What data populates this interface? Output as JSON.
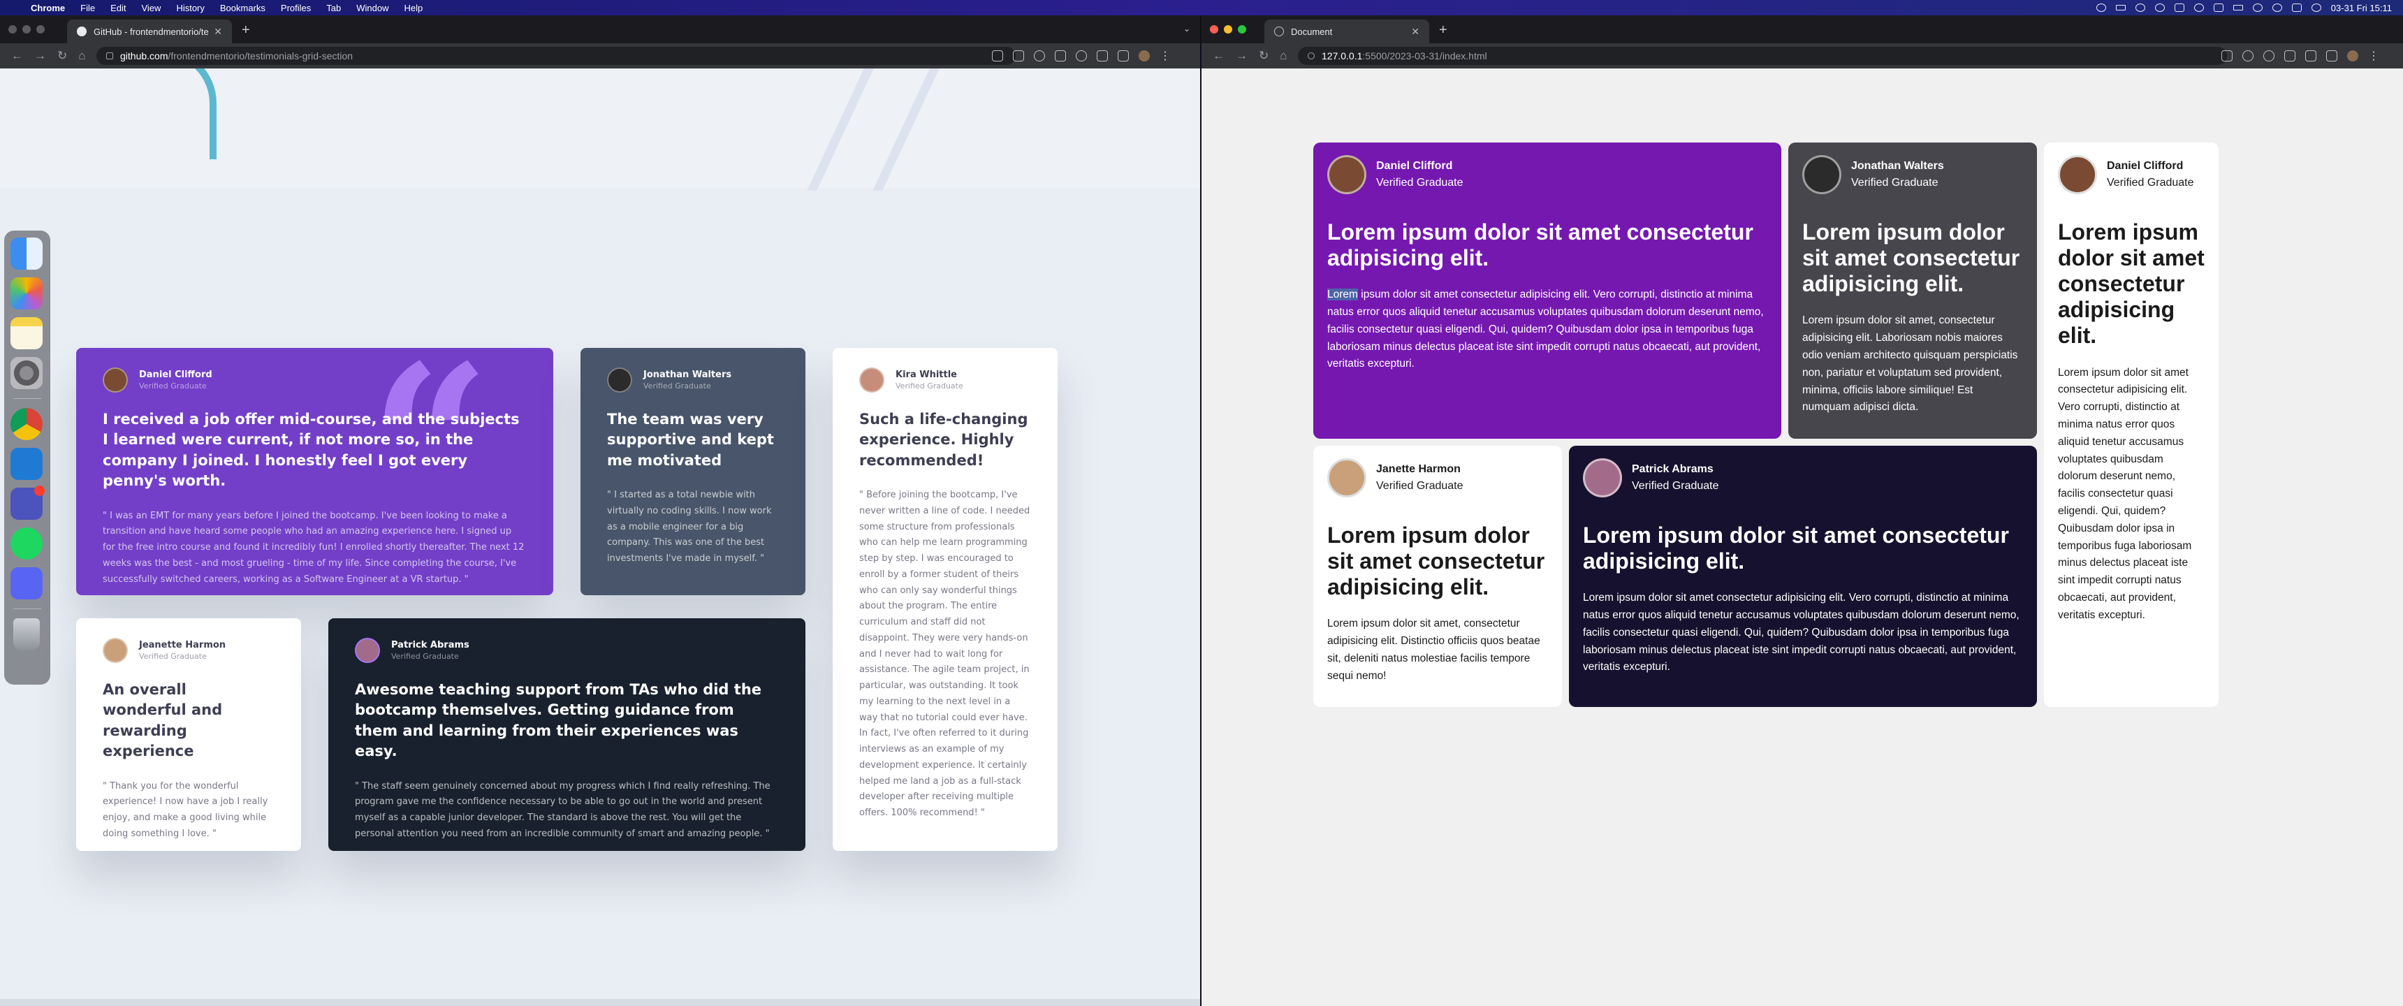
{
  "menubar": {
    "apple": "",
    "items": [
      "Chrome",
      "File",
      "Edit",
      "View",
      "History",
      "Bookmarks",
      "Profiles",
      "Tab",
      "Window",
      "Help"
    ],
    "clock": "03-31 Fri 15:11"
  },
  "left_window": {
    "tab_title": "GitHub - frontendmentorio/te",
    "url_host": "github.com",
    "url_path": "/frontendmentorio/testimonials-grid-section",
    "design": {
      "cards": [
        {
          "name": "Daniel Clifford",
          "role": "Verified Graduate",
          "quote": "I received a job offer mid-course, and the subjects I learned were current, if not more so, in the company I joined. I honestly feel I got every penny's worth.",
          "body": "\" I was an EMT for many years before I joined the bootcamp. I've been looking to make a transition and have heard some people who had an amazing experience here. I signed up for the free intro course and found it incredibly fun! I enrolled shortly thereafter. The next 12 weeks was the best - and most grueling - time of my life. Since completing the course, I've successfully switched careers, working as a Software Engineer at a VR startup. \""
        },
        {
          "name": "Jonathan Walters",
          "role": "Verified Graduate",
          "quote": "The team was very supportive and kept me motivated",
          "body": "\" I started as a total newbie with virtually no coding skills. I now work as a mobile engineer for a big company. This was one of the best investments I've made in myself. \""
        },
        {
          "name": "Kira Whittle",
          "role": "Verified Graduate",
          "quote": "Such a life-changing experience. Highly recommended!",
          "body": "\" Before joining the bootcamp, I've never written a line of code. I needed some structure from professionals who can help me learn programming step by step. I was encouraged to enroll by a former student of theirs who can only say wonderful things about the program. The entire curriculum and staff did not disappoint. They were very hands-on and I never had to wait long for assistance. The agile team project, in particular, was outstanding. It took my learning to the next level in a way that no tutorial could ever have. In fact, I've often referred to it during interviews as an example of my development experience. It certainly helped me land a job as a full-stack developer after receiving multiple offers. 100% recommend! \""
        },
        {
          "name": "Jeanette Harmon",
          "role": "Verified Graduate",
          "quote": "An overall wonderful and rewarding experience",
          "body": "\" Thank you for the wonderful experience! I now have a job I really enjoy, and make a good living while doing something I love. \""
        },
        {
          "name": "Patrick Abrams",
          "role": "Verified Graduate",
          "quote": "Awesome teaching support from TAs who did the bootcamp themselves. Getting guidance from them and learning from their experiences was easy.",
          "body": "\" The staff seem genuinely concerned about my progress which I find really refreshing. The program gave me the confidence necessary to be able to go out in the world and present myself as a capable junior developer. The standard is above the rest. You will get the personal attention you need from an incredible community of smart and amazing people. \""
        }
      ]
    }
  },
  "right_window": {
    "tab_title": "Document",
    "url_host": "127.0.0.1",
    "url_path": ":5500/2023-03-31/index.html",
    "cards": [
      {
        "name": "Daniel Clifford",
        "role": "Verified Graduate",
        "quote": "Lorem ipsum dolor sit amet consectetur adipisicing elit.",
        "body_selected": "Lorem",
        "body": " ipsum dolor sit amet consectetur adipisicing elit. Vero corrupti, distinctio at minima natus error quos aliquid tenetur accusamus voluptates quibusdam dolorum deserunt nemo, facilis consectetur quasi eligendi. Qui, quidem? Quibusdam dolor ipsa in temporibus fuga laboriosam minus delectus placeat iste sint impedit corrupti natus obcaecati, aut provident, veritatis excepturi."
      },
      {
        "name": "Jonathan Walters",
        "role": "Verified Graduate",
        "quote": "Lorem ipsum dolor sit amet consectetur adipisicing elit.",
        "body": "Lorem ipsum dolor sit amet, consectetur adipisicing elit. Laboriosam nobis maiores odio veniam architecto quisquam perspiciatis non, pariatur et voluptatum sed provident, minima, officiis labore similique! Est numquam adipisci dicta."
      },
      {
        "name": "Daniel Clifford",
        "role": "Verified Graduate",
        "quote": "Lorem ipsum dolor sit amet consectetur adipisicing elit.",
        "body": "Lorem ipsum dolor sit amet consectetur adipisicing elit. Vero corrupti, distinctio at minima natus error quos aliquid tenetur accusamus voluptates quibusdam dolorum deserunt nemo, facilis consectetur quasi eligendi. Qui, quidem? Quibusdam dolor ipsa in temporibus fuga laboriosam minus delectus placeat iste sint impedit corrupti natus obcaecati, aut provident, veritatis excepturi."
      },
      {
        "name": "Janette Harmon",
        "role": "Verified Graduate",
        "quote": "Lorem ipsum dolor sit amet consectetur adipisicing elit.",
        "body": "Lorem ipsum dolor sit amet, consectetur adipisicing elit. Distinctio officiis quos beatae sit, deleniti natus molestiae facilis tempore sequi nemo!"
      },
      {
        "name": "Patrick Abrams",
        "role": "Verified Graduate",
        "quote": "Lorem ipsum dolor sit amet consectetur adipisicing elit.",
        "body": "Lorem ipsum dolor sit amet consectetur adipisicing elit. Vero corrupti, distinctio at minima natus error quos aliquid tenetur accusamus voluptates quibusdam dolorum deserunt nemo, facilis consectetur quasi eligendi. Qui, quidem? Quibusdam dolor ipsa in temporibus fuga laboriosam minus delectus placeat iste sint impedit corrupti natus obcaecati, aut provident, veritatis excepturi."
      }
    ]
  },
  "dock": {
    "apps": [
      "finder-icon",
      "photos-icon",
      "notes-icon",
      "system-settings-icon",
      "chrome-icon",
      "vscode-icon",
      "teams-icon",
      "spotify-icon",
      "discord-icon",
      "trash-icon"
    ]
  },
  "colors": {
    "purple": "#733fc8",
    "gray_blue": "#48556a",
    "navy": "#19212e",
    "student_purple": "#7518b0",
    "student_gray": "#47464d",
    "student_navy": "#16112e"
  }
}
